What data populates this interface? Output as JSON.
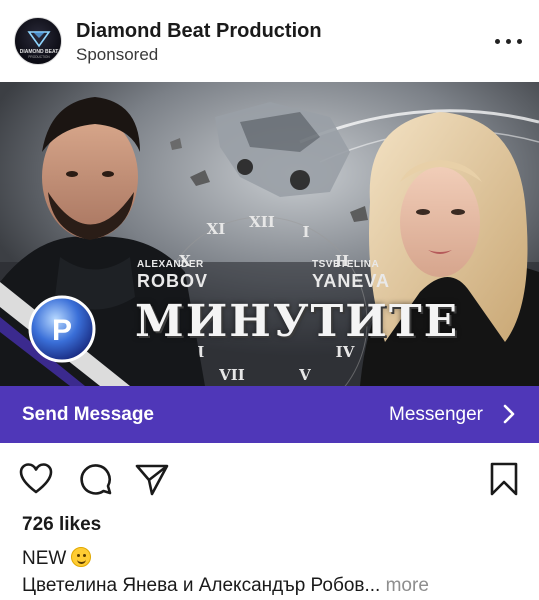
{
  "post": {
    "account_name": "Diamond Beat Production",
    "sponsored_label": "Sponsored",
    "avatar_text": "DIAMOND BEAT",
    "avatar_subtext": "PRODUCTION"
  },
  "media": {
    "artist_left_first": "ALEXANDER",
    "artist_left_last": "ROBOV",
    "artist_right_first": "TSVETELINA",
    "artist_right_last": "YANEVA",
    "song_title": "МИНУТИТЕ",
    "logo_letter": "P",
    "clock_numerals": [
      "XI",
      "XII",
      "I",
      "X",
      "II",
      "VIII",
      "VII",
      "V",
      "IV"
    ]
  },
  "cta": {
    "action_label": "Send Message",
    "destination_label": "Messenger",
    "bar_color": "#4f37b8"
  },
  "actions": {
    "icons": [
      "heart-icon",
      "comment-icon",
      "share-icon",
      "bookmark-icon"
    ]
  },
  "engagement": {
    "likes_text": "726 likes"
  },
  "caption": {
    "line1": "NEW",
    "line2": "Цветелина Янева и Александър Робов...",
    "more_label": "more"
  }
}
